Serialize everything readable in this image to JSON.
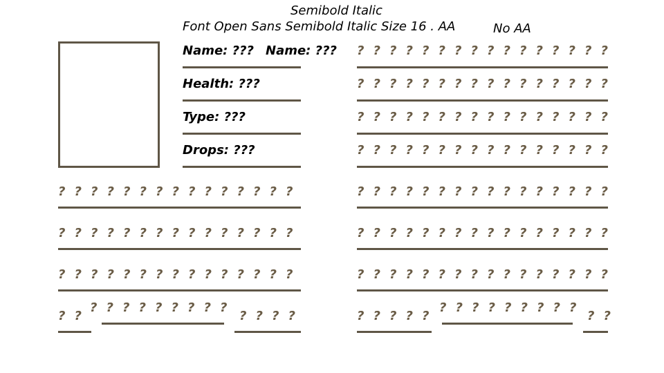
{
  "header": {
    "title": "Semibold Italic",
    "subtitle": "Font Open Sans Semibold Italic Size 16 . AA",
    "no_aa": "No AA"
  },
  "labels": {
    "name_1": "Name: ???",
    "name_2": "Name: ???",
    "health": "Health: ???",
    "type": "Type: ???",
    "drops": "Drops: ???"
  },
  "glyph": "?",
  "rows": {
    "right_top_count": 16,
    "left_full_count": 15,
    "right_full_count": 16
  },
  "colors": {
    "text": "#000000",
    "placeholder": "#6a5c46",
    "rule": "#5f5646"
  }
}
